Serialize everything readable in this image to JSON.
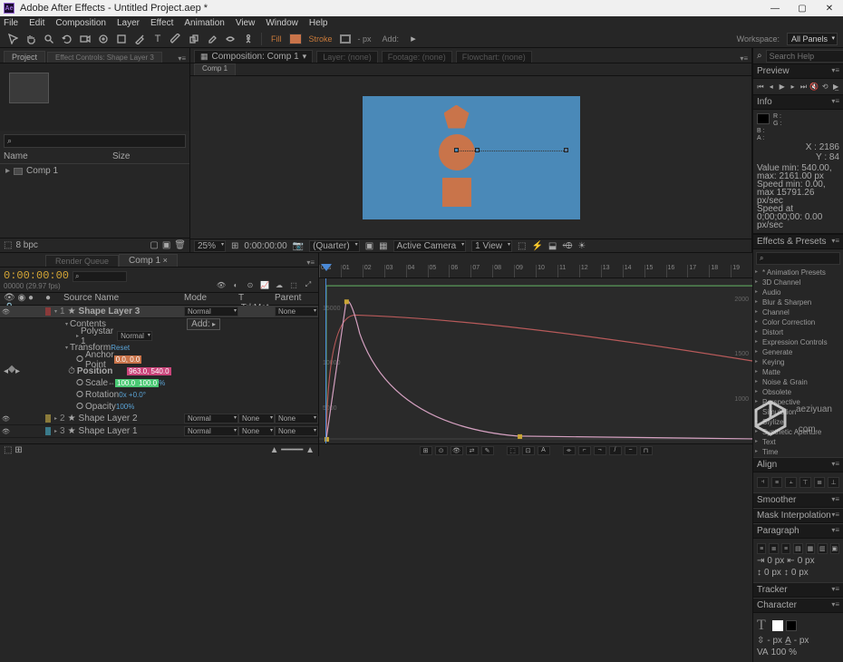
{
  "title": "Adobe After Effects - Untitled Project.aep *",
  "menu": [
    "File",
    "Edit",
    "Composition",
    "Layer",
    "Effect",
    "Animation",
    "View",
    "Window",
    "Help"
  ],
  "toolstrip": {
    "labels": {
      "fill": "Fill",
      "stroke": "Stroke",
      "strokeVal": "- px",
      "add": "Add:"
    }
  },
  "workspace": {
    "label": "Workspace:",
    "value": "All Panels",
    "searchPlaceholder": "Search Help"
  },
  "project": {
    "tab": "Project",
    "subTab": "Effect Controls: Shape Layer 3",
    "searchIcon": "⌕",
    "cols": {
      "name": "Name",
      "size": "Size"
    },
    "item": "Comp 1",
    "footer": {
      "bpc": "8 bpc"
    }
  },
  "composition": {
    "groupLabel": "Composition: Comp 1",
    "layerLabel": "Layer: (none)",
    "footageLabel": "Footage: (none)",
    "flowLabel": "Flowchart: (none)",
    "subTab": "Comp 1",
    "footer": {
      "zoom": "25%",
      "time": "0:00:00:00",
      "res": "(Quarter)",
      "cam": "Active Camera",
      "view": "1 View"
    }
  },
  "preview": {
    "header": "Preview"
  },
  "info": {
    "header": "Info",
    "x": "X : 2186",
    "y": "Y : 84",
    "line1": "Value min: 540.00, max: 2161.00 px",
    "line2": "Speed min: 0.00, max 15791.26 px/sec",
    "line3": "Speed at 0;00;00;00: 0.00 px/sec"
  },
  "effects": {
    "header": "Effects & Presets",
    "items": [
      "* Animation Presets",
      "3D Channel",
      "Audio",
      "Blur & Sharpen",
      "Channel",
      "Color Correction",
      "Distort",
      "Expression Controls",
      "Generate",
      "Keying",
      "Matte",
      "Noise & Grain",
      "Obsolete",
      "Perspective",
      "Simulation",
      "Stylize",
      "Synthetic Aperture",
      "Text",
      "Time"
    ]
  },
  "timeline": {
    "queueTab": "Render Queue",
    "compTab": "Comp 1",
    "timecode": "0:00:00:00",
    "timecodeSub": "00000 (29.97 fps)",
    "cols": {
      "name": "Source Name",
      "mode": "Mode",
      "trk": "T .TrkMat",
      "parent": "Parent"
    },
    "layers": [
      {
        "num": "1",
        "name": "Shape Layer 3",
        "mode": "Normal",
        "parent": "None"
      },
      {
        "num": "2",
        "name": "Shape Layer 2",
        "mode": "Normal",
        "trk": "None",
        "parent": "None"
      },
      {
        "num": "3",
        "name": "Shape Layer 1",
        "mode": "Normal",
        "trk": "None",
        "parent": "None"
      }
    ],
    "shapeContents": {
      "contents": "Contents",
      "add": "Add:",
      "polystar": "Polystar 1",
      "polystarMode": "Normal"
    },
    "transform": {
      "header": "Transform",
      "reset": "Reset",
      "anchor": {
        "name": "Anchor Point",
        "val": "0.0, 0.0"
      },
      "position": {
        "name": "Position",
        "val": "963.0, 540.0"
      },
      "scale": {
        "name": "Scale",
        "val1": "100.0",
        "val2": "100.0",
        "pct": "%"
      },
      "rotation": {
        "name": "Rotation",
        "val": "0x +0.0°"
      },
      "opacity": {
        "name": "Opacity",
        "val": "100%"
      }
    },
    "ruler": [
      "00s",
      "01",
      "02",
      "03",
      "04",
      "05",
      "06",
      "07",
      "08",
      "09",
      "10",
      "11",
      "12",
      "13",
      "14",
      "15",
      "16",
      "17",
      "18",
      "19"
    ],
    "yLabels": {
      "top": "15000",
      "mid": "10000",
      "low": "5000",
      "topR": "2000",
      "midR": "1500",
      "lowR": "1000"
    }
  },
  "rightPanels": {
    "align": "Align",
    "smoother": "Smoother",
    "maskInterp": "Mask Interpolation",
    "paragraph": "Paragraph",
    "tracker": "Tracker",
    "character": "Character",
    "paraVals": {
      "indent": "0 px",
      "space": "0 px"
    },
    "char": {
      "size": "- px",
      "lead": "- %",
      "kern": "100 %"
    }
  },
  "watermark": {
    "l1": "aeziyuan",
    "l2": ".com"
  }
}
